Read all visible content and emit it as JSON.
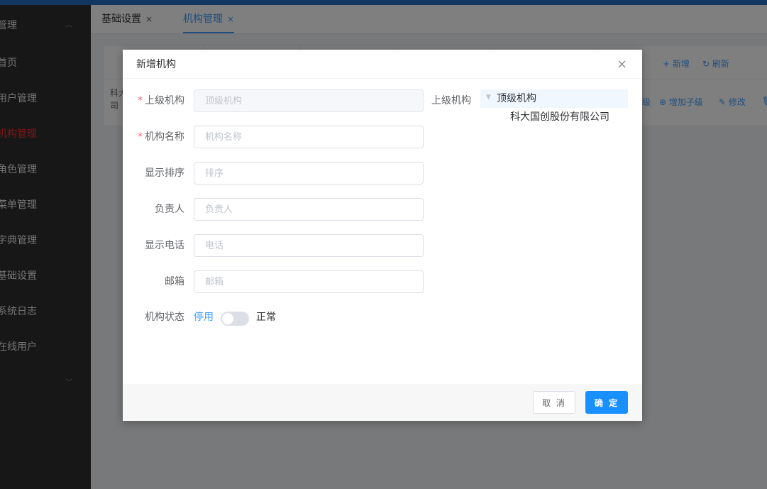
{
  "sidebar": {
    "items": [
      {
        "label": "管理",
        "chevron": "up"
      },
      {
        "label": "首页"
      },
      {
        "label": "用户管理"
      },
      {
        "label": "机构管理",
        "active": true
      },
      {
        "label": "角色管理"
      },
      {
        "label": "菜单管理"
      },
      {
        "label": "字典管理"
      },
      {
        "label": "基础设置"
      },
      {
        "label": "系统日志"
      },
      {
        "label": "在线用户"
      },
      {
        "label": "",
        "chevron": "down"
      }
    ]
  },
  "tabs": [
    {
      "label": "基础设置",
      "close": "×"
    },
    {
      "label": "机构管理",
      "close": "×",
      "active": true
    }
  ],
  "background": {
    "toolbar": {
      "add_label": "+ 新增",
      "refresh_label": "↻ 刷新"
    },
    "row": {
      "name_fragment_1": "科大",
      "name_fragment_2": "司",
      "actions": [
        "级",
        "⊕ 增加子级",
        "✎ 修改",
        "🗑"
      ]
    }
  },
  "dialog": {
    "title": "新增机构",
    "close": "×",
    "form": {
      "parent_org": {
        "label": "上级机构",
        "placeholder": "顶级机构",
        "required": true,
        "disabled": true
      },
      "org_name": {
        "label": "机构名称",
        "placeholder": "机构名称",
        "required": true
      },
      "sort": {
        "label": "显示排序",
        "placeholder": "排序"
      },
      "leader": {
        "label": "负责人",
        "placeholder": "负责人"
      },
      "phone": {
        "label": "显示电话",
        "placeholder": "电话"
      },
      "email": {
        "label": "邮箱",
        "placeholder": "邮箱"
      },
      "status": {
        "label": "机构状态",
        "inactive_text": "停用",
        "active_text": "正常",
        "on": false
      }
    },
    "tree": {
      "label": "上级机构",
      "root": "顶级机构",
      "children": [
        "科大国创股份有限公司"
      ]
    },
    "footer": {
      "cancel": "取 消",
      "ok": "确 定"
    }
  },
  "colors": {
    "primary": "#1890ff",
    "active_menu": "#ff2a2a",
    "sidebar_bg": "#2e2e2e"
  }
}
